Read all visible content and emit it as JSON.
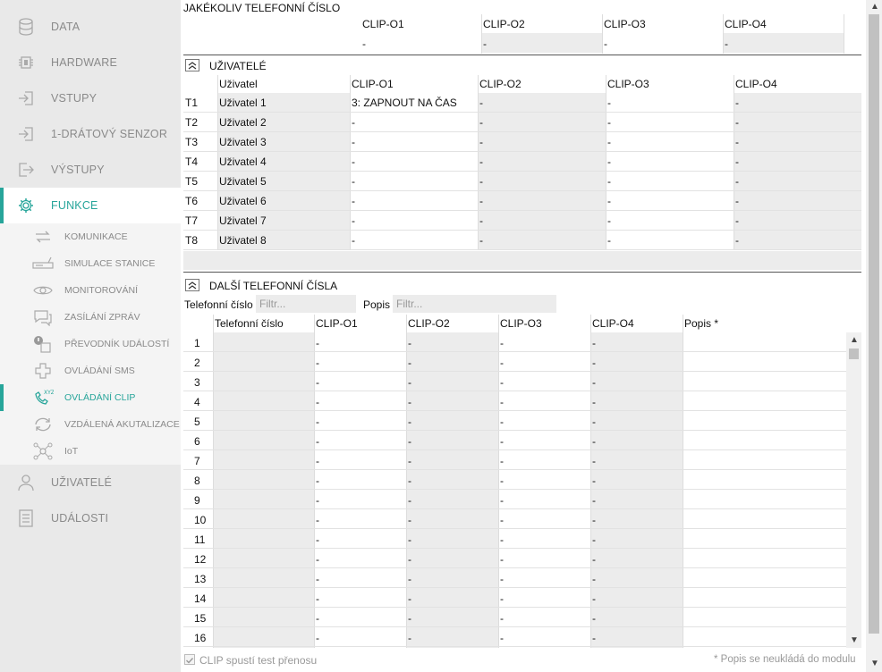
{
  "sidebar": {
    "items": [
      {
        "label": "DATA",
        "icon": "database-icon"
      },
      {
        "label": "HARDWARE",
        "icon": "chip-icon"
      },
      {
        "label": "VSTUPY",
        "icon": "input-icon"
      },
      {
        "label": "1-DRÁTOVÝ SENZOR",
        "icon": "sensor-icon"
      },
      {
        "label": "VÝSTUPY",
        "icon": "output-icon"
      },
      {
        "label": "FUNKCE",
        "icon": "gear-icon"
      }
    ],
    "sub_items": [
      {
        "label": "KOMUNIKACE",
        "icon": "exchange-icon"
      },
      {
        "label": "SIMULACE STANICE",
        "icon": "station-icon"
      },
      {
        "label": "MONITOROVÁNÍ",
        "icon": "eye-icon"
      },
      {
        "label": "ZASÍLÁNÍ ZPRÁV",
        "icon": "message-icon"
      },
      {
        "label": "PŘEVODNÍK UDÁLOSTÍ",
        "icon": "event-converter-icon"
      },
      {
        "label": "OVLÁDÁNÍ SMS",
        "icon": "sms-control-icon"
      },
      {
        "label": "OVLÁDÁNÍ CLIP",
        "icon": "clip-phone-icon"
      },
      {
        "label": "VZDÁLENÁ AKUTALIZACE",
        "icon": "refresh-icon"
      },
      {
        "label": "IoT",
        "icon": "iot-network-icon"
      }
    ],
    "bottom_items": [
      {
        "label": "UŽIVATELÉ",
        "icon": "user-icon"
      },
      {
        "label": "UDÁLOSTI",
        "icon": "events-list-icon"
      }
    ]
  },
  "any_phone": {
    "title": "JAKÉKOLIV TELEFONNÍ ČÍSLO",
    "headers": [
      "CLIP-O1",
      "CLIP-O2",
      "CLIP-O3",
      "CLIP-O4"
    ],
    "values": [
      "-",
      "-",
      "-",
      "-"
    ]
  },
  "users": {
    "title": "UŽIVATELÉ",
    "headers": [
      "Uživatel",
      "CLIP-O1",
      "CLIP-O2",
      "CLIP-O3",
      "CLIP-O4"
    ],
    "rows": [
      {
        "id": "T1",
        "name": "Uživatel 1",
        "o1": "3: ZAPNOUT NA ČAS",
        "o2": "-",
        "o3": "-",
        "o4": "-"
      },
      {
        "id": "T2",
        "name": "Uživatel 2",
        "o1": "-",
        "o2": "-",
        "o3": "-",
        "o4": "-"
      },
      {
        "id": "T3",
        "name": "Uživatel 3",
        "o1": "-",
        "o2": "-",
        "o3": "-",
        "o4": "-"
      },
      {
        "id": "T4",
        "name": "Uživatel 4",
        "o1": "-",
        "o2": "-",
        "o3": "-",
        "o4": "-"
      },
      {
        "id": "T5",
        "name": "Uživatel 5",
        "o1": "-",
        "o2": "-",
        "o3": "-",
        "o4": "-"
      },
      {
        "id": "T6",
        "name": "Uživatel 6",
        "o1": "-",
        "o2": "-",
        "o3": "-",
        "o4": "-"
      },
      {
        "id": "T7",
        "name": "Uživatel 7",
        "o1": "-",
        "o2": "-",
        "o3": "-",
        "o4": "-"
      },
      {
        "id": "T8",
        "name": "Uživatel 8",
        "o1": "-",
        "o2": "-",
        "o3": "-",
        "o4": "-"
      }
    ]
  },
  "other_phones": {
    "title": "DALŠÍ TELEFONNÍ ČÍSLA",
    "filter_phone_label": "Telefonní číslo",
    "filter_phone_placeholder": "Filtr...",
    "filter_desc_label": "Popis",
    "filter_desc_placeholder": "Filtr...",
    "headers": [
      "Telefonní číslo",
      "CLIP-O1",
      "CLIP-O2",
      "CLIP-O3",
      "CLIP-O4",
      "Popis *"
    ],
    "rows": [
      {
        "n": "1",
        "o1": "-",
        "o2": "-",
        "o3": "-",
        "o4": "-"
      },
      {
        "n": "2",
        "o1": "-",
        "o2": "-",
        "o3": "-",
        "o4": "-"
      },
      {
        "n": "3",
        "o1": "-",
        "o2": "-",
        "o3": "-",
        "o4": "-"
      },
      {
        "n": "4",
        "o1": "-",
        "o2": "-",
        "o3": "-",
        "o4": "-"
      },
      {
        "n": "5",
        "o1": "-",
        "o2": "-",
        "o3": "-",
        "o4": "-"
      },
      {
        "n": "6",
        "o1": "-",
        "o2": "-",
        "o3": "-",
        "o4": "-"
      },
      {
        "n": "7",
        "o1": "-",
        "o2": "-",
        "o3": "-",
        "o4": "-"
      },
      {
        "n": "8",
        "o1": "-",
        "o2": "-",
        "o3": "-",
        "o4": "-"
      },
      {
        "n": "9",
        "o1": "-",
        "o2": "-",
        "o3": "-",
        "o4": "-"
      },
      {
        "n": "10",
        "o1": "-",
        "o2": "-",
        "o3": "-",
        "o4": "-"
      },
      {
        "n": "11",
        "o1": "-",
        "o2": "-",
        "o3": "-",
        "o4": "-"
      },
      {
        "n": "12",
        "o1": "-",
        "o2": "-",
        "o3": "-",
        "o4": "-"
      },
      {
        "n": "13",
        "o1": "-",
        "o2": "-",
        "o3": "-",
        "o4": "-"
      },
      {
        "n": "14",
        "o1": "-",
        "o2": "-",
        "o3": "-",
        "o4": "-"
      },
      {
        "n": "15",
        "o1": "-",
        "o2": "-",
        "o3": "-",
        "o4": "-"
      },
      {
        "n": "16",
        "o1": "-",
        "o2": "-",
        "o3": "-",
        "o4": "-"
      }
    ]
  },
  "footer": {
    "checkbox_label": "CLIP spustí test přenosu",
    "checkbox_checked": true,
    "note": "* Popis se neukládá do modulu"
  },
  "colors": {
    "accent": "#27a59a",
    "sidebar_bg": "#e9e9e9",
    "cell_gray": "#ececec"
  }
}
